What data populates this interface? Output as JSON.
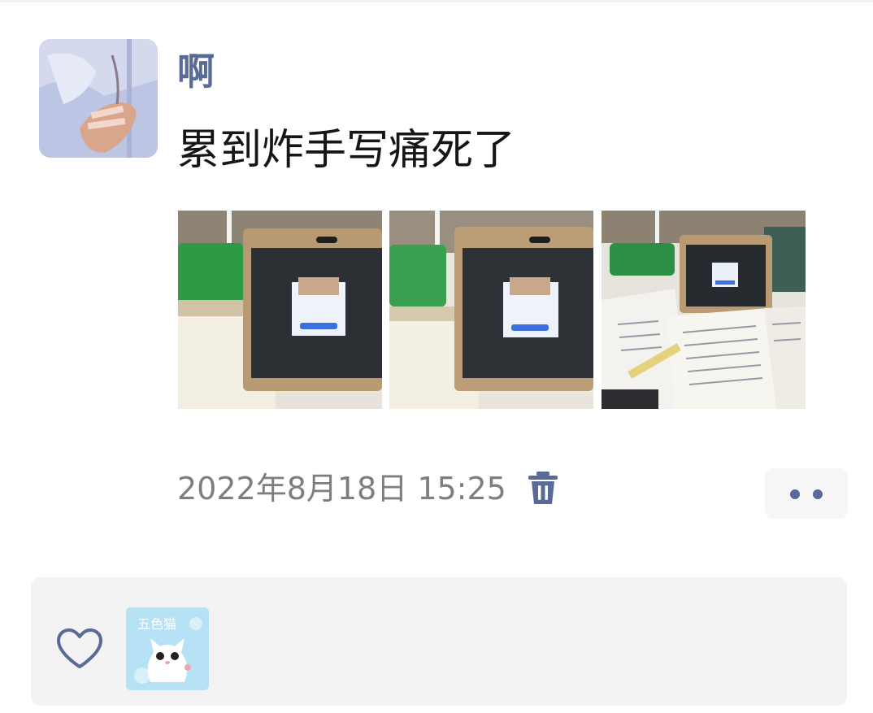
{
  "post": {
    "username": "啊",
    "text": "累到炸手写痛死了",
    "timestamp": "2022年8月18日 15:25",
    "photos": [
      {
        "icon": "photo-tablet-desk"
      },
      {
        "icon": "photo-tablet-desk"
      },
      {
        "icon": "photo-notebook-tablet"
      }
    ]
  },
  "icons": {
    "delete": "trash-icon",
    "more": "more-dots-icon",
    "like": "heart-outline-icon"
  },
  "likes": {
    "avatars": [
      {
        "icon": "cat-avatar",
        "logo_text": "五色猫"
      }
    ]
  },
  "colors": {
    "username": "#5a6a96",
    "accent": "#5a6a96",
    "text": "#161616",
    "timestamp": "#7e7e7e",
    "panel_bg": "#f3f3f3"
  }
}
